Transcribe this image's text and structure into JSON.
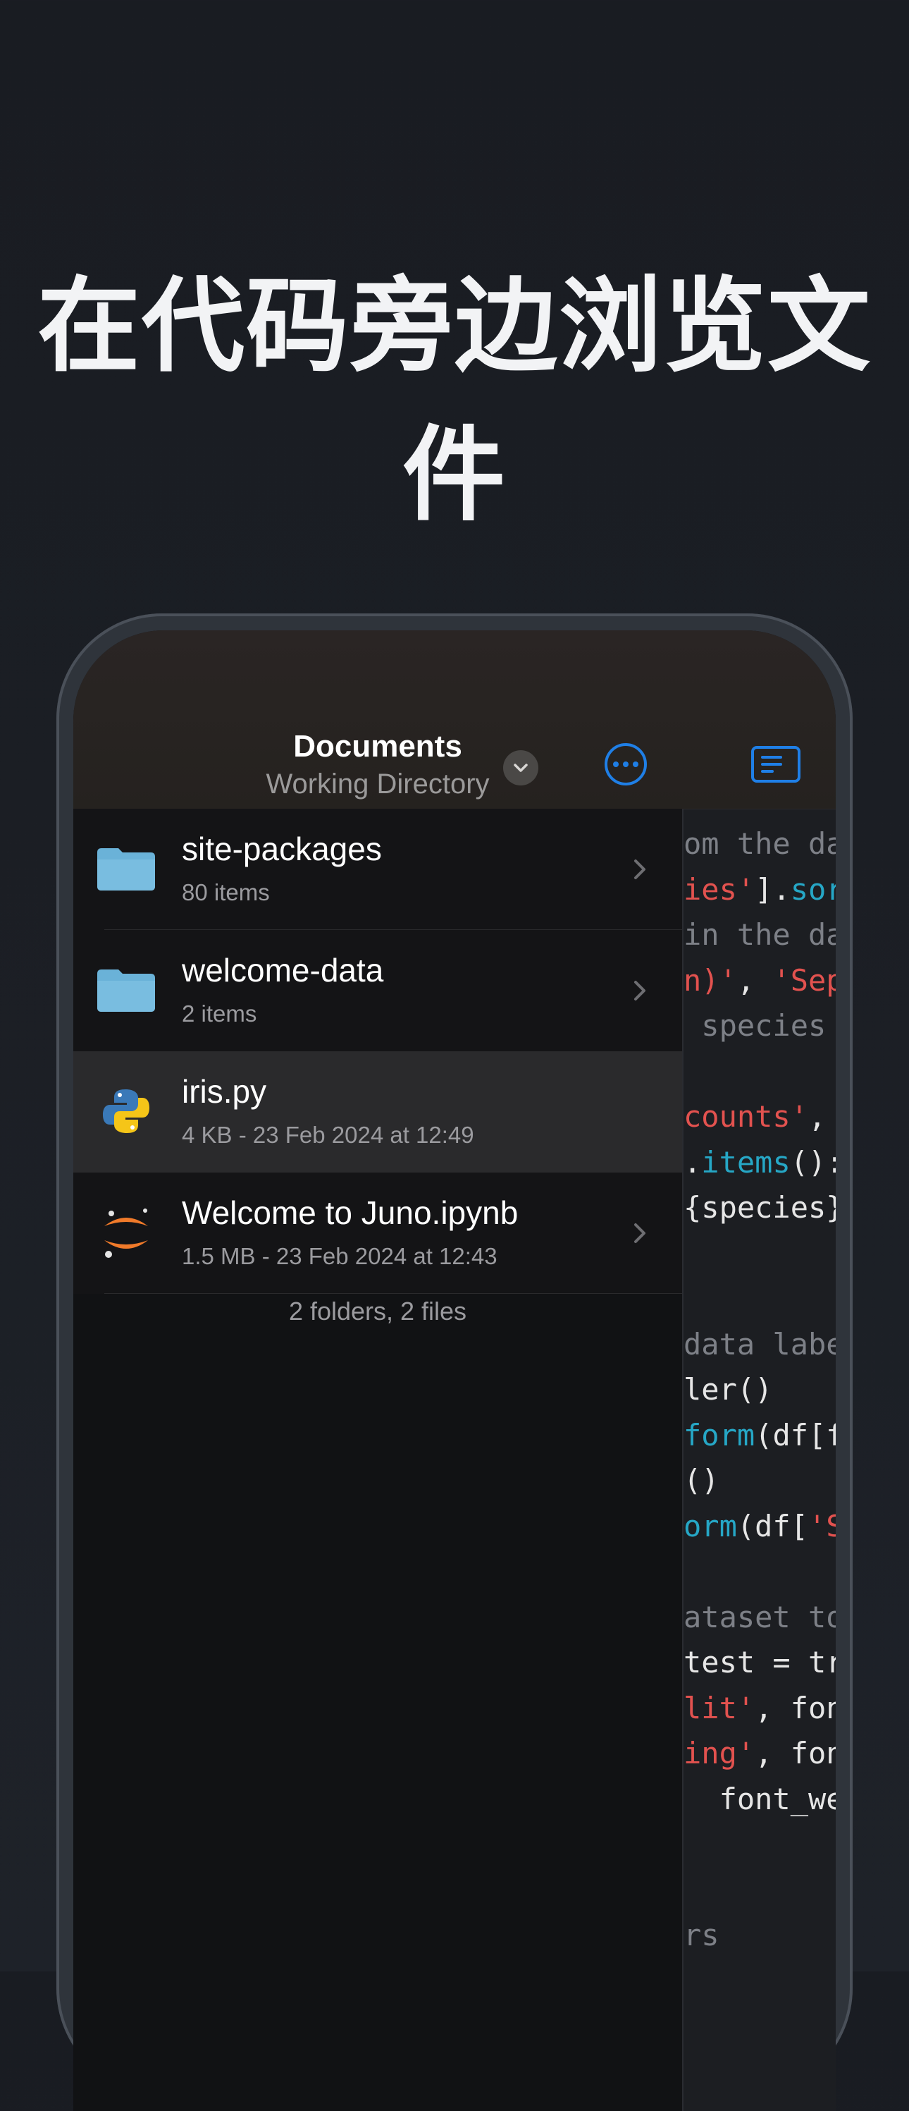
{
  "headline": "在代码旁边浏览文件",
  "nav": {
    "title": "Documents",
    "subtitle": "Working Directory"
  },
  "files": [
    {
      "name": "site-packages",
      "meta": "80 items",
      "icon": "folder-icon"
    },
    {
      "name": "welcome-data",
      "meta": "2 items",
      "icon": "folder-icon"
    },
    {
      "name": "iris.py",
      "meta": "4 KB - 23 Feb 2024 at 12:49",
      "icon": "python-icon"
    },
    {
      "name": "Welcome to Juno.ipynb",
      "meta": "1.5 MB - 23 Feb 2024 at 12:43",
      "icon": "jupyter-icon"
    }
  ],
  "summary": "2 folders, 2 files",
  "code_lines": [
    [
      {
        "t": "om the da",
        "c": "com"
      }
    ],
    [
      {
        "t": "ies'",
        "c": "str"
      },
      {
        "t": "].",
        "c": "pln"
      },
      {
        "t": "sor",
        "c": "fn"
      }
    ],
    [
      {
        "t": "in the da",
        "c": "com"
      }
    ],
    [
      {
        "t": "n)'",
        "c": "str"
      },
      {
        "t": ", ",
        "c": "pln"
      },
      {
        "t": "'Sep",
        "c": "str"
      }
    ],
    [
      {
        "t": " species",
        "c": "com"
      }
    ],
    [
      {
        "t": "",
        "c": "pln"
      }
    ],
    [
      {
        "t": "counts'",
        "c": "str"
      },
      {
        "t": ",",
        "c": "pln"
      }
    ],
    [
      {
        "t": ".",
        "c": "pln"
      },
      {
        "t": "items",
        "c": "fn"
      },
      {
        "t": "():",
        "c": "pln"
      }
    ],
    [
      {
        "t": "{species}",
        "c": "pln"
      }
    ],
    [
      {
        "t": "",
        "c": "pln"
      }
    ],
    [
      {
        "t": "",
        "c": "pln"
      }
    ],
    [
      {
        "t": "data labe",
        "c": "com"
      }
    ],
    [
      {
        "t": "ler()",
        "c": "pln"
      }
    ],
    [
      {
        "t": "form",
        "c": "fn"
      },
      {
        "t": "(df[f",
        "c": "pln"
      }
    ],
    [
      {
        "t": "()",
        "c": "pln"
      }
    ],
    [
      {
        "t": "orm",
        "c": "fn"
      },
      {
        "t": "(df[",
        "c": "pln"
      },
      {
        "t": "'S",
        "c": "str"
      }
    ],
    [
      {
        "t": "",
        "c": "pln"
      }
    ],
    [
      {
        "t": "ataset to",
        "c": "com"
      }
    ],
    [
      {
        "t": "test = tr",
        "c": "pln"
      }
    ],
    [
      {
        "t": "lit'",
        "c": "str"
      },
      {
        "t": ", fon",
        "c": "pln"
      }
    ],
    [
      {
        "t": "ing'",
        "c": "str"
      },
      {
        "t": ", fon",
        "c": "pln"
      }
    ],
    [
      {
        "t": "  font_we",
        "c": "pln"
      }
    ],
    [
      {
        "t": "",
        "c": "pln"
      }
    ],
    [
      {
        "t": "",
        "c": "pln"
      }
    ],
    [
      {
        "t": "rs",
        "c": "com"
      }
    ]
  ]
}
